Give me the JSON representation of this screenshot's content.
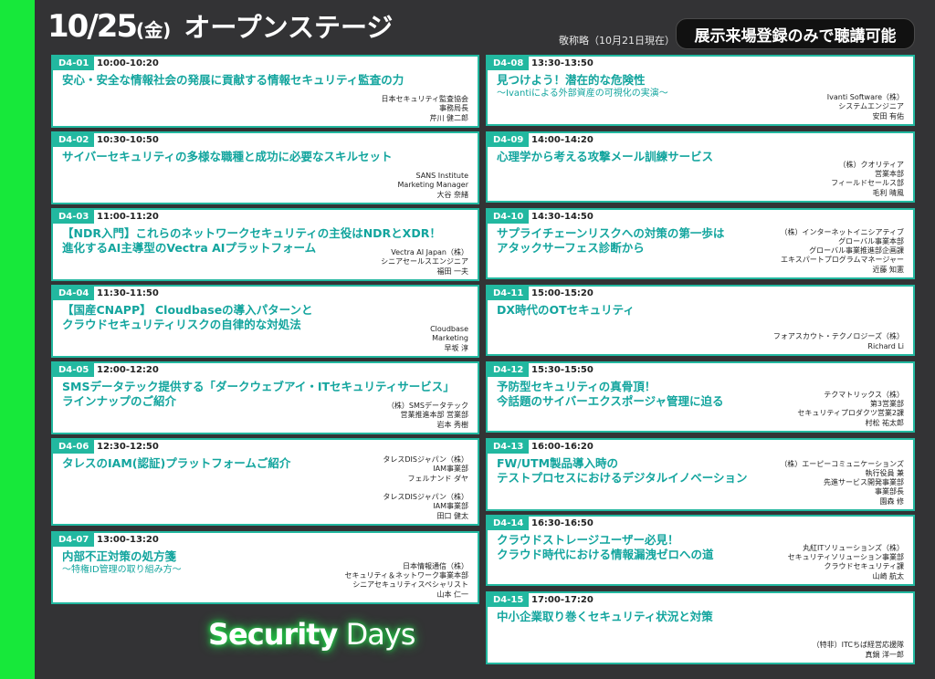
{
  "header": {
    "date": "10/25",
    "day_of_week": "(金)",
    "stage": "オープンステージ",
    "honorific": "敬称略（10月21日現在）",
    "badge": "展示来場登録のみで聴講可能"
  },
  "left": [
    {
      "code": "D4-01",
      "time": "10:00-10:20",
      "title_lines": [
        "安心・安全な情報社会の発展に貢献する情報セキュリティ監査の力"
      ],
      "subtitle": "",
      "speaker_lines": [
        "日本セキュリティ監査協会",
        "事務局長",
        "芹川 健二郎"
      ]
    },
    {
      "code": "D4-02",
      "time": "10:30-10:50",
      "title_lines": [
        "サイバーセキュリティの多様な職種と成功に必要なスキルセット"
      ],
      "subtitle": "",
      "speaker_lines": [
        "SANS Institute",
        "Marketing Manager",
        "大谷 奈緒"
      ]
    },
    {
      "code": "D4-03",
      "time": "11:00-11:20",
      "title_lines": [
        "【NDR入門】これらのネットワークセキュリティの主役はNDRとXDR！",
        "進化するAI主導型のVectra AIプラットフォーム"
      ],
      "subtitle": "",
      "speaker_lines": [
        "Vectra AI Japan（株）",
        "シニアセールスエンジニア",
        "福田 一夫"
      ]
    },
    {
      "code": "D4-04",
      "time": "11:30-11:50",
      "title_lines": [
        "【国産CNAPP】 Cloudbaseの導入パターンと",
        "クラウドセキュリティリスクの自律的な対処法"
      ],
      "subtitle": "",
      "speaker_lines": [
        "Cloudbase",
        "Marketing",
        "早坂 淳"
      ]
    },
    {
      "code": "D4-05",
      "time": "12:00-12:20",
      "title_lines": [
        "SMSデータテック提供する「ダークウェブアイ・ITセキュリティサービス」",
        "ラインナップのご紹介"
      ],
      "subtitle": "",
      "speaker_lines": [
        "（株）SMSデータテック",
        "営業推進本部 営業部",
        "岩本 秀樹"
      ]
    },
    {
      "code": "D4-06",
      "time": "12:30-12:50",
      "title_lines": [
        "タレスのIAM(認証)プラットフォームご紹介"
      ],
      "subtitle": "",
      "speaker_lines": [
        "タレスDISジャパン（株）",
        "IAM事業部",
        "フェルナンド ダヤ",
        "",
        "タレスDISジャパン（株）",
        "IAM事業部",
        "田口 健太"
      ]
    },
    {
      "code": "D4-07",
      "time": "13:00-13:20",
      "title_lines": [
        "内部不正対策の処方箋"
      ],
      "subtitle": "～特権ID管理の取り組み方～",
      "speaker_lines": [
        "日本情報通信（株）",
        "セキュリティ＆ネットワーク事業本部",
        "シニアセキュリティスペシャリスト",
        "山本 仁一"
      ]
    }
  ],
  "right": [
    {
      "code": "D4-08",
      "time": "13:30-13:50",
      "title_lines": [
        "見つけよう！潜在的な危険性"
      ],
      "subtitle": "～Ivantiによる外部資産の可視化の実演～",
      "speaker_lines": [
        "Ivanti Software（株）",
        "システムエンジニア",
        "安田 有佑"
      ]
    },
    {
      "code": "D4-09",
      "time": "14:00-14:20",
      "title_lines": [
        "心理学から考える攻撃メール訓練サービス"
      ],
      "subtitle": "",
      "speaker_lines": [
        "（株）クオリティア",
        "営業本部",
        "フィールドセールス部",
        "毛利 晴風"
      ]
    },
    {
      "code": "D4-10",
      "time": "14:30-14:50",
      "title_lines": [
        "サプライチェーンリスクへの対策の第一歩は",
        "アタックサーフェス診断から"
      ],
      "subtitle": "",
      "speaker_lines": [
        "（株）インターネットイニシアティブ",
        "グローバル事業本部",
        "グローバル事業推進部企画課",
        "エキスパートプログラムマネージャー",
        "近藤 知憲"
      ]
    },
    {
      "code": "D4-11",
      "time": "15:00-15:20",
      "title_lines": [
        "DX時代のOTセキュリティ"
      ],
      "subtitle": "",
      "speaker_lines": [
        "フォアスカウト・テクノロジーズ（株）",
        "Richard Li"
      ]
    },
    {
      "code": "D4-12",
      "time": "15:30-15:50",
      "title_lines": [
        "予防型セキュリティの真骨頂！",
        "今話題のサイバーエクスポージャ管理に迫る"
      ],
      "subtitle": "",
      "speaker_lines": [
        "テクマトリックス（株）",
        "第3営業部",
        "セキュリティプロダクツ営業2課",
        "村松 祐太郎"
      ]
    },
    {
      "code": "D4-13",
      "time": "16:00-16:20",
      "title_lines": [
        "FW/UTM製品導入時の",
        "テストプロセスにおけるデジタルイノベーション"
      ],
      "subtitle": "",
      "speaker_lines": [
        "（株）エーピーコミュニケーションズ",
        "執行役員 兼",
        "先進サービス開発事業部",
        "事業部長",
        "園森 修"
      ]
    },
    {
      "code": "D4-14",
      "time": "16:30-16:50",
      "title_lines": [
        "クラウドストレージユーザー必見！",
        "クラウド時代における情報漏洩ゼロへの道"
      ],
      "subtitle": "",
      "speaker_lines": [
        "丸紅ITソリューションズ（株）",
        "セキュリティソリューション事業部",
        "クラウドセキュリティ課",
        "山崎 航太"
      ]
    },
    {
      "code": "D4-15",
      "time": "17:00-17:20",
      "title_lines": [
        "中小企業取り巻くセキュリティ状況と対策"
      ],
      "subtitle": "",
      "speaker_lines": [
        "（特非）ITCちば経営応援隊",
        "真鍋 洋一郎"
      ]
    }
  ],
  "logo": {
    "part1": "Security",
    "part2": " Days"
  }
}
